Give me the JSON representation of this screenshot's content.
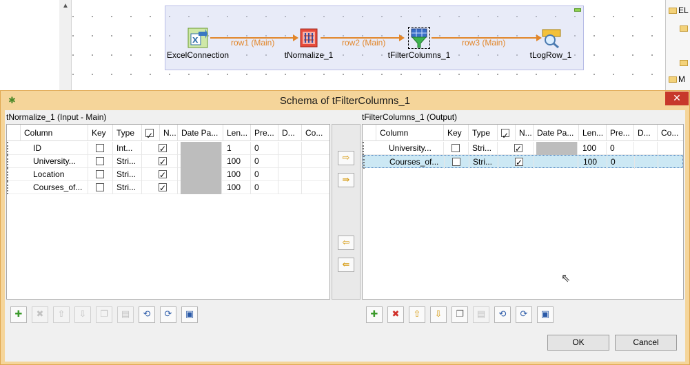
{
  "canvas": {
    "nodes": [
      {
        "label": "ExcelConnection",
        "icon": "excel-input-icon"
      },
      {
        "label": "tNormalize_1",
        "icon": "normalize-icon"
      },
      {
        "label": "tFilterColumns_1",
        "icon": "filter-columns-icon"
      },
      {
        "label": "tLogRow_1",
        "icon": "logrow-icon"
      }
    ],
    "connections": [
      "row1 (Main)",
      "row2 (Main)",
      "row3 (Main)"
    ],
    "right_panel": [
      "EL",
      "M"
    ]
  },
  "dialog": {
    "title": "Schema of tFilterColumns_1",
    "close_glyph": "✕",
    "left": {
      "label": "tNormalize_1 (Input - Main)",
      "headers": [
        "Column",
        "Key",
        "Type",
        "N...",
        "Date Pa...",
        "Len...",
        "Pre...",
        "D...",
        "Co..."
      ],
      "rows": [
        {
          "column": "ID",
          "key": false,
          "type": "Int...",
          "nullable": true,
          "length": "1",
          "precision": "0"
        },
        {
          "column": "University...",
          "key": false,
          "type": "Stri...",
          "nullable": true,
          "length": "100",
          "precision": "0"
        },
        {
          "column": "Location",
          "key": false,
          "type": "Stri...",
          "nullable": true,
          "length": "100",
          "precision": "0"
        },
        {
          "column": "Courses_of...",
          "key": false,
          "type": "Stri...",
          "nullable": true,
          "length": "100",
          "precision": "0"
        }
      ]
    },
    "right": {
      "label": "tFilterColumns_1 (Output)",
      "headers": [
        "Column",
        "Key",
        "Type",
        "N...",
        "Date Pa...",
        "Len...",
        "Pre...",
        "D...",
        "Co..."
      ],
      "rows": [
        {
          "column": "University...",
          "key": false,
          "type": "Stri...",
          "nullable": true,
          "length": "100",
          "precision": "0"
        },
        {
          "column": "Courses_of...",
          "key": false,
          "type": "Stri...",
          "nullable": true,
          "length": "100",
          "precision": "0"
        }
      ]
    },
    "buttons": {
      "ok": "OK",
      "cancel": "Cancel"
    }
  },
  "colors": {
    "dialog_frame": "#f5d59a",
    "connection": "#e2862a",
    "selection": "#cce8f4",
    "close": "#c7382b"
  }
}
